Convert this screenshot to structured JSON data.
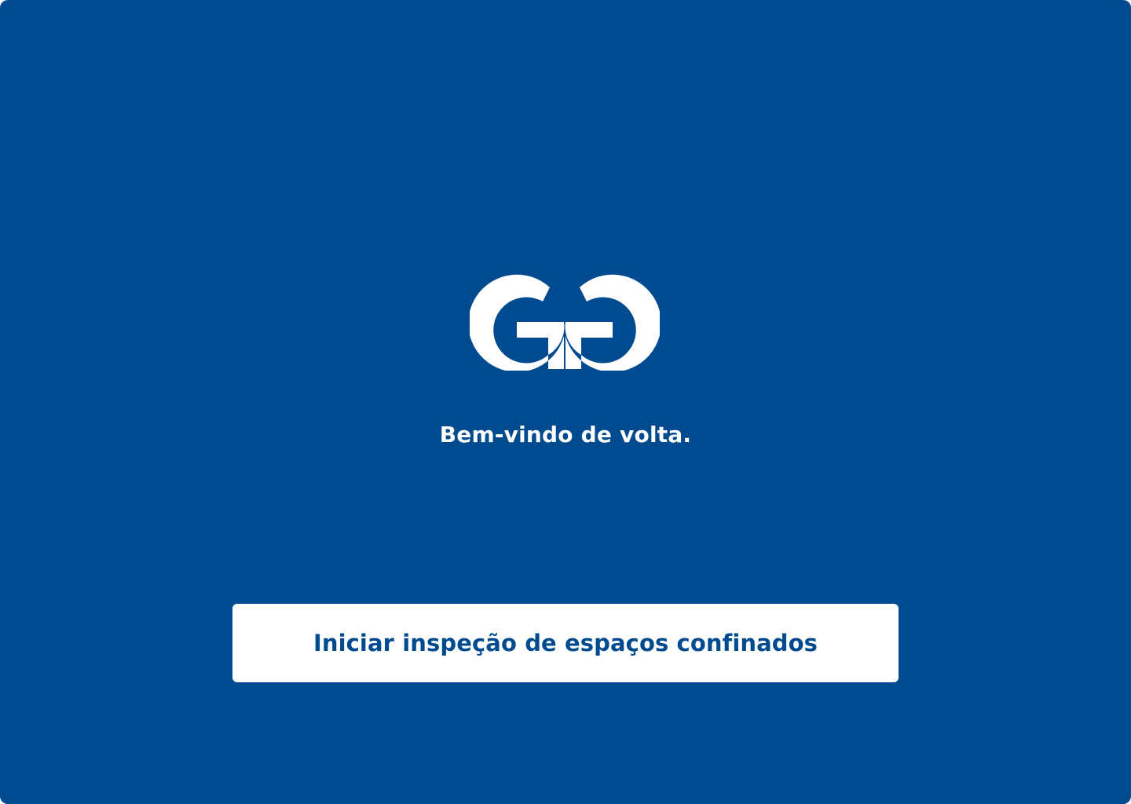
{
  "app": {
    "background_color": "#004A8F",
    "accent_color": "#FFFFFF"
  },
  "logo": {
    "icon": "gg-logo-icon"
  },
  "welcome": {
    "text": "Bem-vindo de volta."
  },
  "start_button": {
    "label": "Iniciar inspeção de espaços confinados"
  }
}
